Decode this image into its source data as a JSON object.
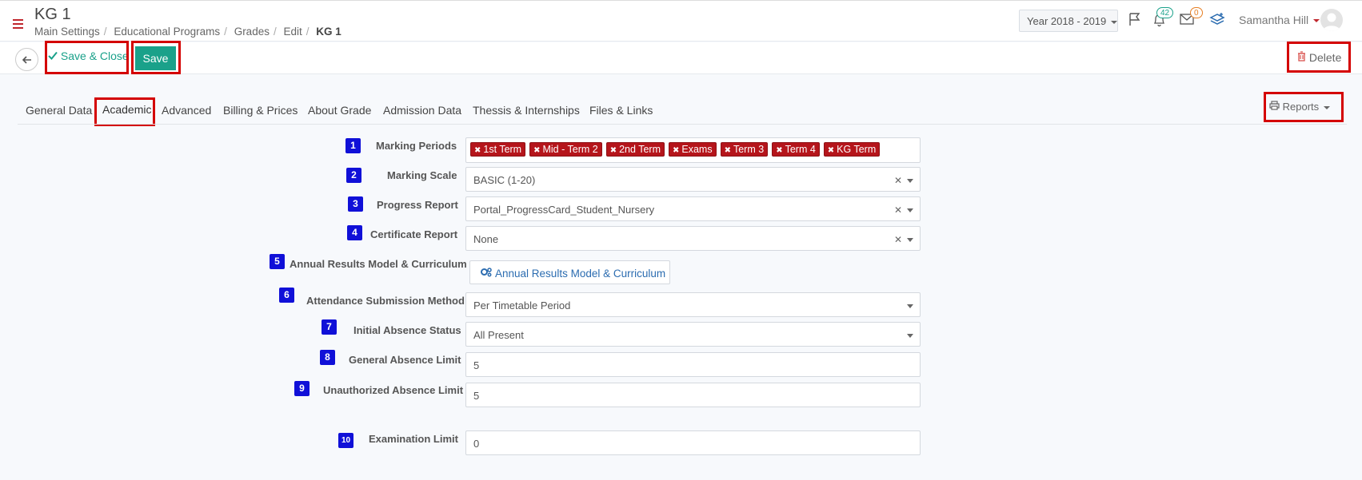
{
  "header": {
    "title": "KG 1",
    "breadcrumb": [
      "Main Settings",
      "Educational Programs",
      "Grades",
      "Edit"
    ],
    "breadcrumb_current": "KG 1",
    "year": "Year 2018 - 2019",
    "notifications_count": "42",
    "messages_count": "0",
    "user_name": "Samantha Hill"
  },
  "toolbar": {
    "save_close_label": "Save & Close",
    "save_label": "Save",
    "delete_label": "Delete"
  },
  "tabs": [
    "General Data",
    "Academic",
    "Advanced",
    "Billing & Prices",
    "About Grade",
    "Admission Data",
    "Thessis & Internships",
    "Files & Links"
  ],
  "reports_label": "Reports",
  "form": {
    "marking_periods": {
      "num": "1",
      "label": "Marking Periods",
      "tags": [
        "1st Term",
        "Mid - Term 2",
        "2nd Term",
        "Exams",
        "Term 3",
        "Term 4",
        "KG Term"
      ]
    },
    "marking_scale": {
      "num": "2",
      "label": "Marking Scale",
      "value": "BASIC (1-20)"
    },
    "progress_report": {
      "num": "3",
      "label": "Progress Report",
      "value": "Portal_ProgressCard_Student_Nursery"
    },
    "certificate_report": {
      "num": "4",
      "label": "Certificate Report",
      "value": "None"
    },
    "annual_results": {
      "num": "5",
      "label": "Annual Results Model & Curriculum",
      "button": "Annual Results Model & Curriculum"
    },
    "attendance_method": {
      "num": "6",
      "label": "Attendance Submission Method",
      "value": "Per Timetable Period"
    },
    "initial_absence": {
      "num": "7",
      "label": "Initial Absence Status",
      "value": "All Present"
    },
    "general_absence_limit": {
      "num": "8",
      "label": "General Absence Limit",
      "value": "5"
    },
    "unauthorized_absence_limit": {
      "num": "9",
      "label": "Unauthorized Absence Limit",
      "value": "5"
    },
    "examination_limit": {
      "num": "10",
      "label": "Examination Limit",
      "value": "0"
    }
  },
  "colors": {
    "accent": "#1aa18a",
    "tag": "#b5151b",
    "highlight": "#d40000",
    "step_badge": "#1010d8"
  }
}
